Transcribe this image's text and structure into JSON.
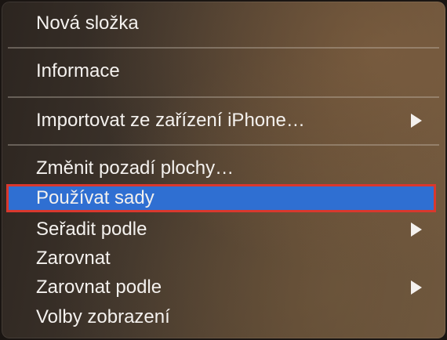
{
  "menu": {
    "new_folder": "Nová složka",
    "info": "Informace",
    "import_iphone": "Importovat ze zařízení iPhone…",
    "change_wallpaper": "Změnit pozadí plochy…",
    "use_stacks": "Používat sady",
    "sort_by": "Seřadit podle",
    "align": "Zarovnat",
    "align_by": "Zarovnat podle",
    "view_options": "Volby zobrazení"
  },
  "colors": {
    "highlight": "#2f6fd2",
    "outline": "#d9382e"
  }
}
